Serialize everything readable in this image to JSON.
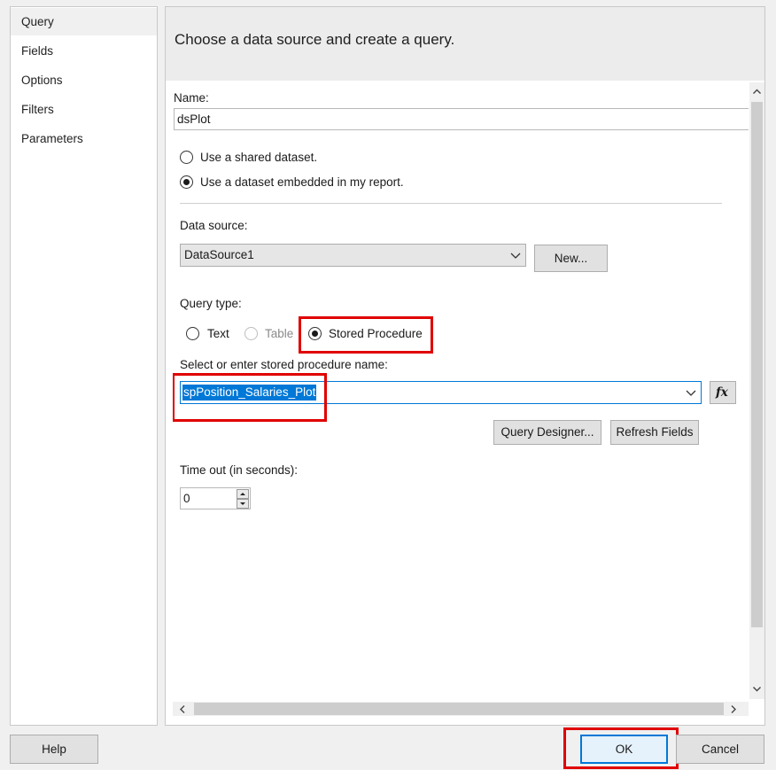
{
  "nav": {
    "items": [
      {
        "label": "Query",
        "selected": true
      },
      {
        "label": "Fields",
        "selected": false
      },
      {
        "label": "Options",
        "selected": false
      },
      {
        "label": "Filters",
        "selected": false
      },
      {
        "label": "Parameters",
        "selected": false
      }
    ]
  },
  "header": {
    "title": "Choose a data source and create a query."
  },
  "form": {
    "name_label": "Name:",
    "name_value": "dsPlot",
    "dataset_options": [
      {
        "label": "Use a shared dataset.",
        "checked": false
      },
      {
        "label": "Use a dataset embedded in my report.",
        "checked": true
      }
    ],
    "data_source_label": "Data source:",
    "data_source_value": "DataSource1",
    "new_button": "New...",
    "query_type_label": "Query type:",
    "query_types": [
      {
        "label": "Text",
        "checked": false,
        "enabled": true
      },
      {
        "label": "Table",
        "checked": false,
        "enabled": false
      },
      {
        "label": "Stored Procedure",
        "checked": true,
        "enabled": true
      }
    ],
    "sp_label": "Select or enter stored procedure name:",
    "sp_value": "spPosition_Salaries_Plot",
    "fx_button": "fx",
    "query_designer_button": "Query Designer...",
    "refresh_fields_button": "Refresh Fields",
    "timeout_label": "Time out (in seconds):",
    "timeout_value": "0"
  },
  "footer": {
    "help": "Help",
    "ok": "OK",
    "cancel": "Cancel"
  },
  "colors": {
    "highlight": "#e00000",
    "selection": "#0078d7",
    "accent_border": "#0078d7"
  }
}
